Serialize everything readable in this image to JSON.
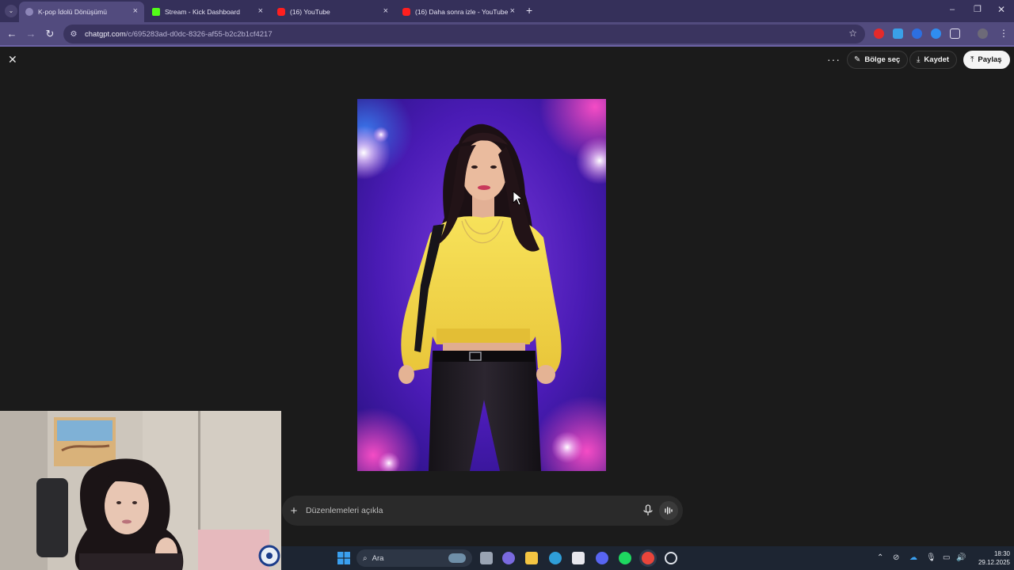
{
  "browser": {
    "tabs": [
      {
        "title": "K-pop İdolü Dönüşümü",
        "active": true
      },
      {
        "title": "Stream - Kick Dashboard",
        "active": false
      },
      {
        "title": "(16) YouTube",
        "active": false
      },
      {
        "title": "(16) Daha sonra izle - YouTube",
        "active": false
      }
    ],
    "url_host": "chatgpt.com",
    "url_path": "/c/695283ad-d0dc-8326-af55-b2c2b1cf4217"
  },
  "viewer": {
    "actions": {
      "select_area": "Bölge seç",
      "save": "Kaydet",
      "share": "Paylaş"
    },
    "composer_placeholder": "Düzenlemeleri açıkla"
  },
  "taskbar": {
    "search_label": "Ara",
    "time": "18:30",
    "date": "29.12.2025"
  },
  "colors": {
    "tab_strip": "#35305a",
    "toolbar": "#524b7e",
    "page_bg": "#1b1b1b",
    "sweater": "#f2d84a",
    "stage_purple": "#5a1fd0",
    "stage_pink": "#ff2fb0"
  }
}
